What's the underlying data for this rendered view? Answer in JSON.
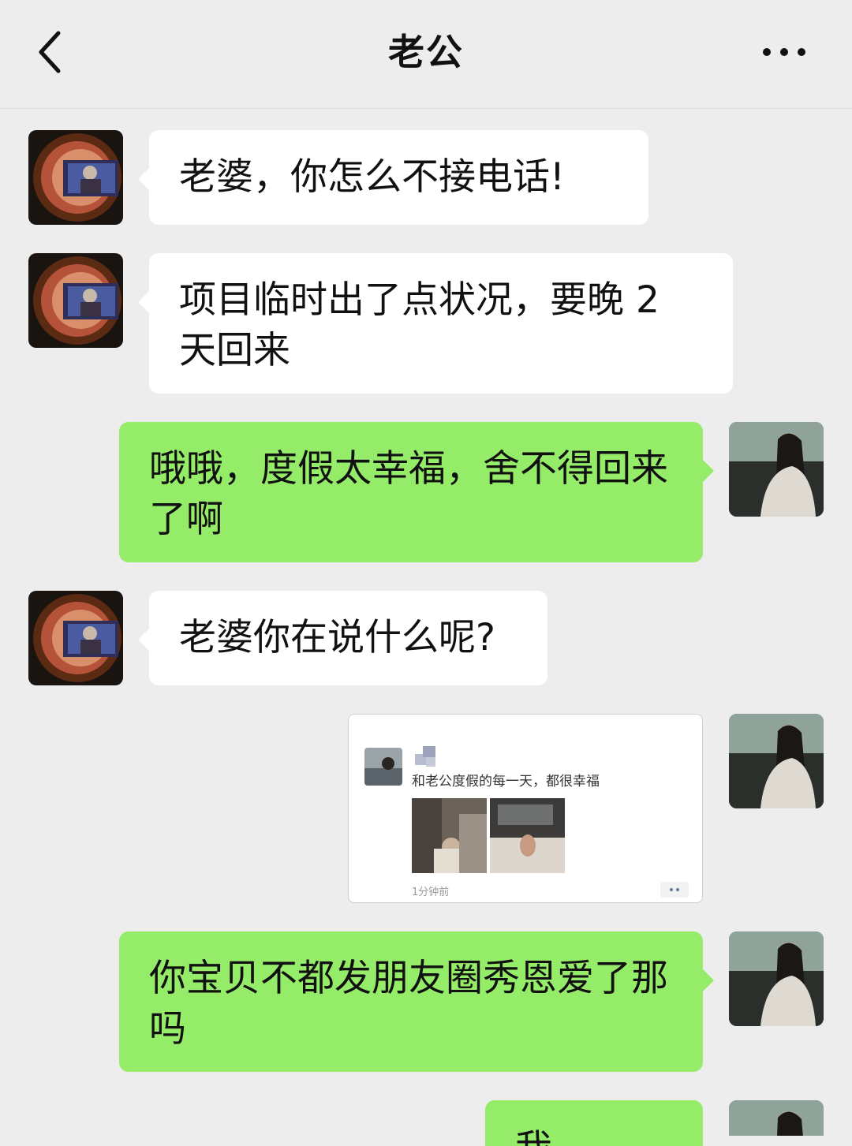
{
  "header": {
    "title": "老公"
  },
  "messages": [
    {
      "side": "left",
      "text": "老婆，你怎么不接电话!"
    },
    {
      "side": "left",
      "text": "项目临时出了点状况，要晚 2 天回来"
    },
    {
      "side": "right",
      "text": "哦哦，度假太幸福，舍不得回来了啊"
    },
    {
      "side": "left",
      "text": "老婆你在说什么呢?"
    },
    {
      "side": "right",
      "type": "shared-post",
      "post_text": "和老公度假的每一天，都很幸福",
      "post_time": "1分钟前"
    },
    {
      "side": "right",
      "text": "你宝贝不都发朋友圈秀恩爱了那吗"
    },
    {
      "side": "right",
      "text": "我..."
    }
  ],
  "colors": {
    "background": "#ededed",
    "incoming_bubble": "#ffffff",
    "outgoing_bubble": "#95ec69"
  },
  "icons": {
    "back": "chevron-left-icon",
    "more": "more-dots-icon"
  }
}
